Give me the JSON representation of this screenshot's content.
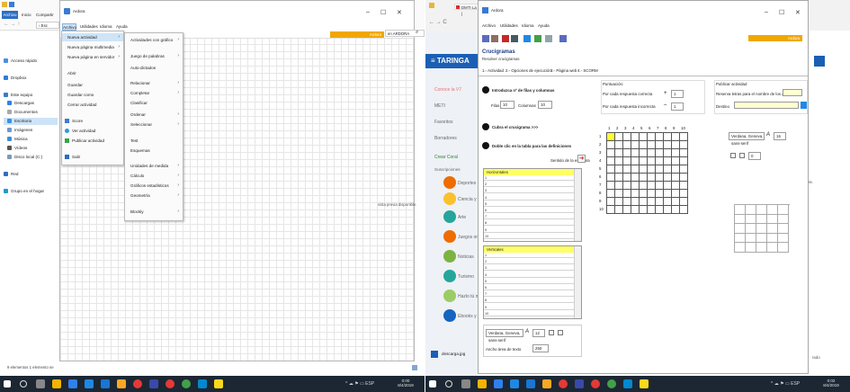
{
  "left": {
    "window_title": "Ardora",
    "explorer_tabs": [
      "Archivo",
      "Inicio",
      "Compartir"
    ],
    "app_menu": [
      "Archivo",
      "Utilidades",
      "Idioma",
      "Ayuda"
    ],
    "main_menu": [
      "Nueva actividad",
      "Nueva página multimedia",
      "Nueva página en servidor",
      "Abrir",
      "Guardar",
      "Guardar como",
      "Cerrar actividad",
      "Score",
      "Ver actividad",
      "Publicar actividad",
      "Salir"
    ],
    "category_menu": [
      "Actividades con gráfico",
      "Juego de palabras",
      "Auto-dictados",
      "Relacionar",
      "Completar",
      "Clasificar",
      "Ordenar",
      "Seleccionar",
      "Test",
      "Esquemas",
      "Unidades de medida",
      "Cálculo",
      "Gráficos estadísticos",
      "Geometría",
      "Blockly"
    ],
    "sidebar": [
      "Acceso rápido",
      "Dropbox",
      "Este equipo",
      "Descargas",
      "Documentos",
      "Escritorio",
      "Imágenes",
      "Música",
      "Vídeos",
      "Disco local (C:)",
      "Red",
      "Grupo en el hogar"
    ],
    "ardora_badge": "Ardora",
    "search_text": "en ARDORA",
    "preview_text": "vista previa disponible.",
    "status_bar": "9 elementos   1 elemento se",
    "clock_time": "0:00",
    "clock_date": "8/4/2019"
  },
  "right": {
    "window_title": "Ardora",
    "browser_tab": "DMTI La Web |",
    "app_menu": [
      "Archivo",
      "Utilidades",
      "Idioma",
      "Ayuda"
    ],
    "activity_title": "Crucigramas",
    "activity_subtitle": "Resolver crucigramas",
    "tabs": [
      "1.- Actividad",
      "2.- Opciones de ejecución",
      "3.- Página web",
      "4.- SCORM"
    ],
    "step1": "Introduzca nº de filas y columnas",
    "filas_label": "Filas",
    "filas_value": "10",
    "columnas_label": "Columnas",
    "columnas_value": "10",
    "step2": "Cubra el crucigrama >>>",
    "step3": "Doble clic en la tabla para las definiciones",
    "sentido_label": "Sentido de la escritura",
    "horizontales": "Horizontales",
    "verticales": "Verticales",
    "row_numbers": [
      "1",
      "2",
      "3",
      "4",
      "5",
      "6",
      "7",
      "8",
      "9",
      "10"
    ],
    "col_numbers": [
      "1",
      "2",
      "3",
      "4",
      "5",
      "6",
      "7",
      "8",
      "9",
      "10"
    ],
    "puntuacion_label": "Puntuación:",
    "correcta_label": "Por cada respuesta correcta",
    "correcta_value": "1",
    "incorrecta_label": "Por cada respuesta incorrecta",
    "incorrecta_value": "1",
    "publicar_label": "Publicar actividad",
    "reserva_label": "Reserva letras para el nombre de los archivos",
    "destino_label": "Destino",
    "font_name": "Verdana, Geneva, sans-serif",
    "font_size": "12",
    "font_size2": "16",
    "small_value": "0",
    "ancho_label": "Ancho área de texto",
    "ancho_value": "250",
    "ardora_badge": "Ardora",
    "page_nav": [
      "Conoce la V7",
      "METI",
      "Favoritos",
      "Borradores",
      "Crear Coral",
      "Suscripciones"
    ],
    "site_logo": "TARINGA",
    "bubble_items": [
      "Deportes",
      "Ciencia y e",
      "Arte",
      "Juegos onl",
      "Noticias",
      "Turismo",
      "Hazlo tú m",
      "Ebooks y t"
    ],
    "download_file": "descarga.jpg",
    "right_text": "ponible.",
    "right_text2": "rado",
    "clock_time": "0:02",
    "clock_date": "8/4/2019"
  },
  "colors": {
    "accent": "#f0a800",
    "taskbar": "#1c2733",
    "menu_highlight": "#cfe4f7",
    "cell_yellow": "#ffff33",
    "definitions_yellow": "#ffffa8",
    "taringa_blue": "#1a5fb4"
  }
}
